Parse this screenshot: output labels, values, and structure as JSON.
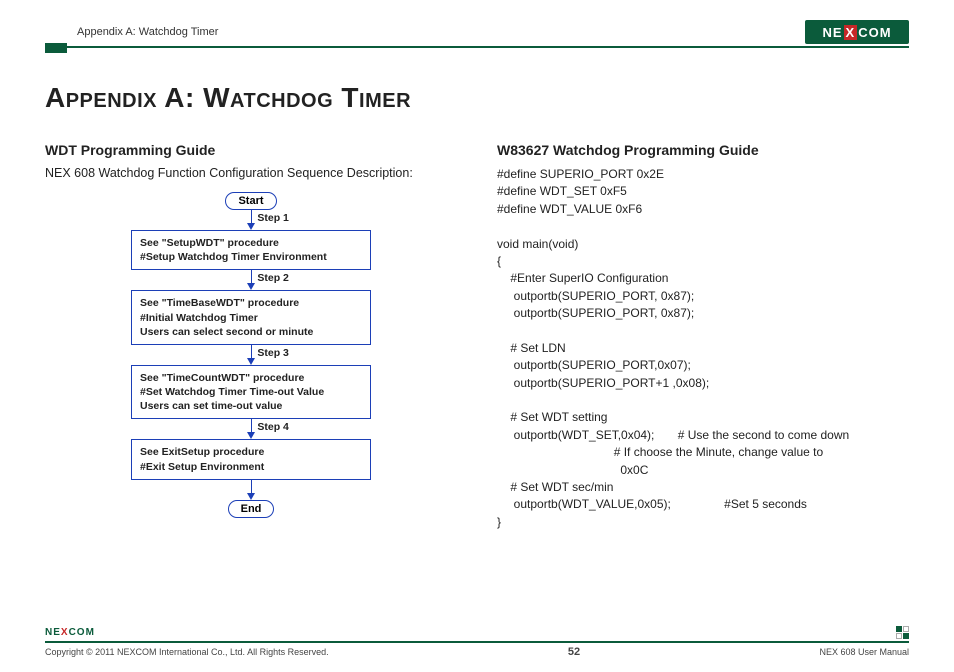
{
  "header": {
    "section": "Appendix A: Watchdog Timer",
    "logo_text_a": "NE",
    "logo_text_x": "X",
    "logo_text_b": "COM"
  },
  "title": "Appendix A: Watchdog Timer",
  "left": {
    "heading": "WDT Programming Guide",
    "desc": "NEX 608 Watchdog Function Configuration Sequence Description:",
    "start": "Start",
    "end": "End",
    "step1": "Step 1",
    "step2": "Step 2",
    "step3": "Step 3",
    "step4": "Step 4",
    "box1_l1": "See \"SetupWDT\" procedure",
    "box1_l2": "#Setup Watchdog Timer Environment",
    "box2_l1": "See \"TimeBaseWDT\" procedure",
    "box2_l2": "#Initial Watchdog Timer",
    "box2_l3": "Users can select second or minute",
    "box3_l1": "See \"TimeCountWDT\" procedure",
    "box3_l2": "#Set Watchdog Timer Time-out Value",
    "box3_l3": "Users can set time-out value",
    "box4_l1": "See ExitSetup procedure",
    "box4_l2": "#Exit Setup Environment"
  },
  "right": {
    "heading": "W83627 Watchdog Programming Guide",
    "code": "#define SUPERIO_PORT 0x2E\n#define WDT_SET 0xF5\n#define WDT_VALUE 0xF6\n\nvoid main(void)\n{\n    #Enter SuperIO Configuration\n     outportb(SUPERIO_PORT, 0x87);\n     outportb(SUPERIO_PORT, 0x87);\n\n    # Set LDN\n     outportb(SUPERIO_PORT,0x07);\n     outportb(SUPERIO_PORT+1 ,0x08);\n\n    # Set WDT setting\n     outportb(WDT_SET,0x04);       # Use the second to come down\n                                   # If choose the Minute, change value to\n                                     0x0C\n    # Set WDT sec/min\n     outportb(WDT_VALUE,0x05);                #Set 5 seconds\n}"
  },
  "footer": {
    "copyright": "Copyright © 2011 NEXCOM International Co., Ltd. All Rights Reserved.",
    "page": "52",
    "doc": "NEX 608 User Manual"
  }
}
